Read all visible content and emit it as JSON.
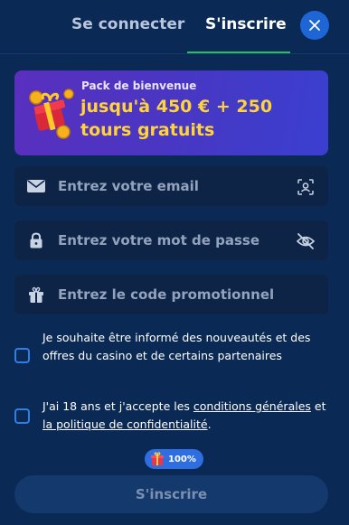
{
  "tabs": {
    "login_label": "Se connecter",
    "signup_label": "S'inscrire",
    "active": "signup"
  },
  "close_icon": "close-icon",
  "banner": {
    "kicker": "Pack de bienvenue",
    "headline": "jusqu'à 450 € + 250 tours gratuits",
    "icon": "gift-coins-icon"
  },
  "fields": {
    "email": {
      "placeholder": "Entrez votre email",
      "value": "",
      "lead_icon": "envelope-icon",
      "trail_icon": "face-scan-icon"
    },
    "password": {
      "placeholder": "Entrez votre mot de passe",
      "value": "",
      "lead_icon": "lock-icon",
      "trail_icon": "eye-off-icon"
    },
    "promo": {
      "placeholder": "Entrez le code promotionnel",
      "value": "",
      "lead_icon": "gift-icon"
    }
  },
  "checkboxes": {
    "newsletter": {
      "text": "Je souhaite être informé des nouveautés et des offres du casino et de certains partenaires",
      "checked": false
    },
    "terms": {
      "prefix": "J'ai 18 ans et j'accepte les ",
      "link1": "conditions générales",
      "middle": " et ",
      "link2": "la politique de confidentialité",
      "suffix": ".",
      "checked": false
    }
  },
  "bonus_badge": {
    "icon": "gift-icon",
    "percent": "100%"
  },
  "submit": {
    "label": "S'inscrire"
  },
  "colors": {
    "background": "#0a2a55",
    "accent": "#1e66d6",
    "tab_underline": "#2dbd5c",
    "headline_yellow": "#ffd33a",
    "banner_purple": "#5a2fbf",
    "field_bg": "#0d2447",
    "checkbox_border": "#2f7fe6"
  }
}
